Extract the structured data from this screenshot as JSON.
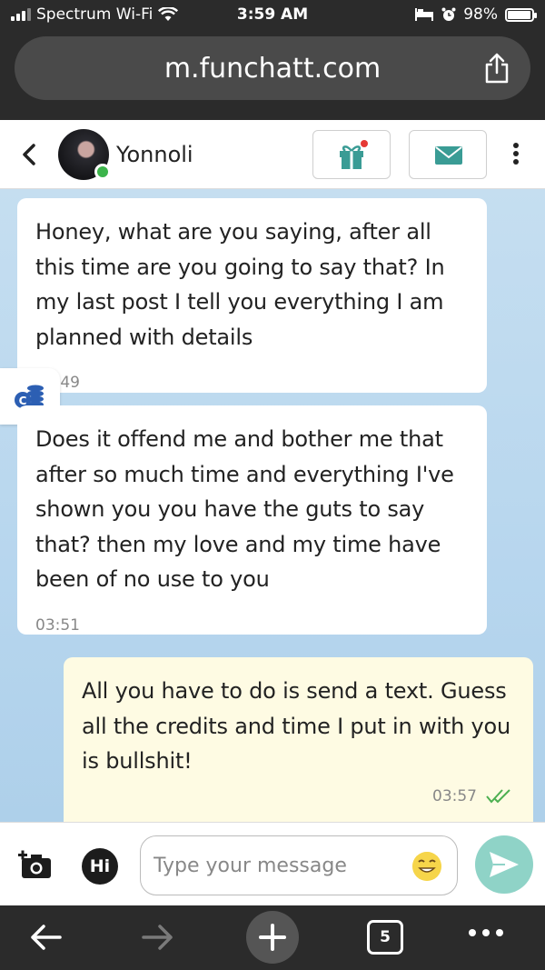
{
  "status_bar": {
    "carrier": "Spectrum Wi-Fi",
    "time": "3:59 AM",
    "battery": "98%",
    "battery_level": 0.98
  },
  "browser": {
    "url": "m.funchatt.com",
    "open_tabs": "5"
  },
  "chat": {
    "contact_name": "Yonnoli",
    "online": true
  },
  "messages": [
    {
      "direction": "incoming",
      "text": "Honey, what are you saying, after all this time are you going to say that? In my last post I tell you everything I am planned with details",
      "time": "03:49"
    },
    {
      "direction": "incoming",
      "text": "Does it offend me and bother me that after so much time and everything I've shown you you have the guts to say that? then my love and my time have been of no use to you",
      "time": "03:51"
    },
    {
      "direction": "outgoing",
      "text": "All you have to do is send a text. Guess all the credits and time I put in with you is bullshit!",
      "time": "03:57",
      "status": "read"
    }
  ],
  "composer": {
    "hi_label": "Hi",
    "placeholder": "Type your message"
  },
  "icons": {
    "gift": "gift-icon",
    "mail": "mail-icon",
    "credits": "coins-icon",
    "camera": "camera-add-icon",
    "send": "send-icon"
  },
  "colors": {
    "accent": "#3a9c95",
    "send_button": "#8fd3c7",
    "chat_bg": "#b7d6ee",
    "outgoing_bubble": "#fefbe3",
    "read_check": "#4caf50",
    "gift_dot": "#e53935",
    "credits_icon": "#2c5fb3"
  }
}
